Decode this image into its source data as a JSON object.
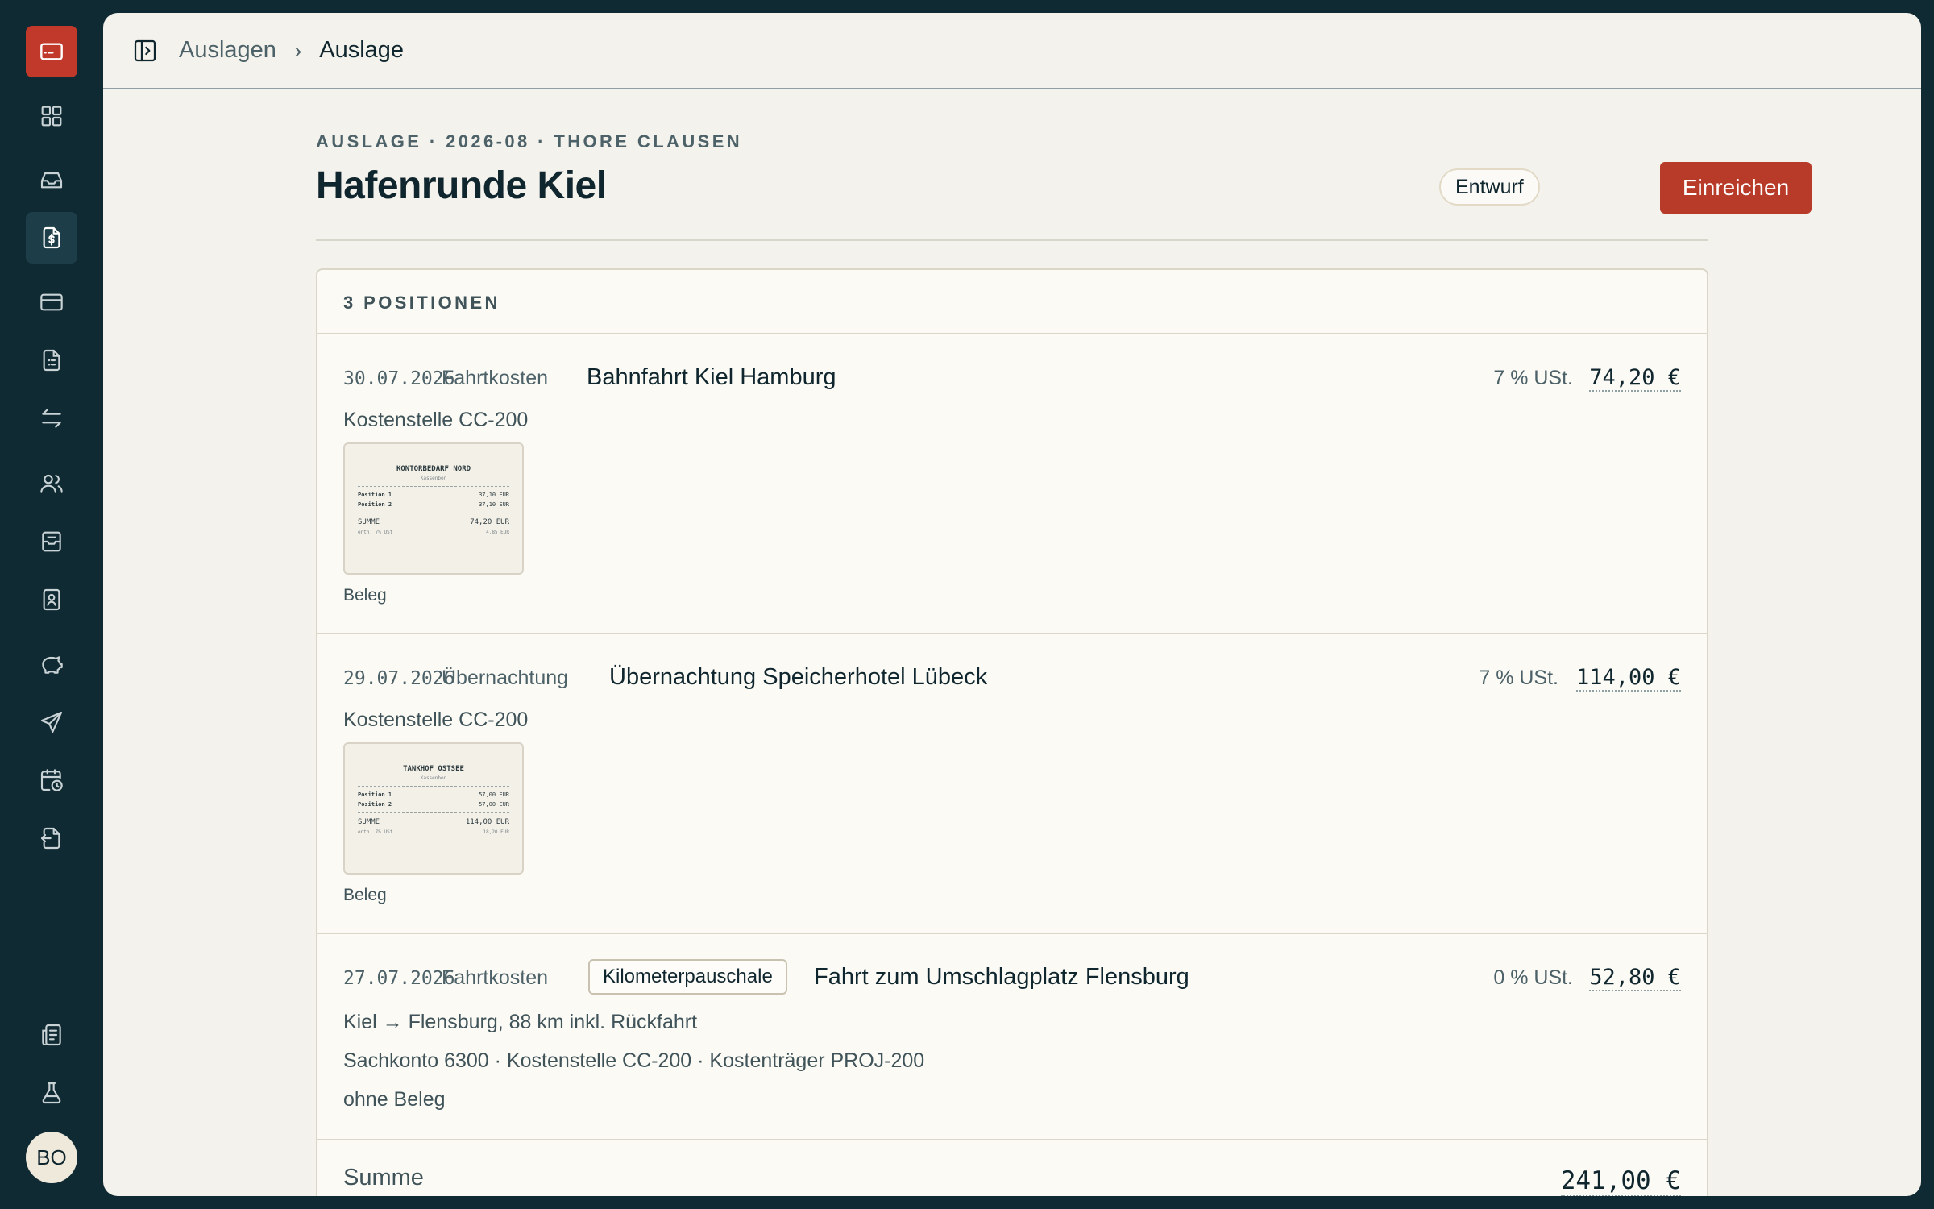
{
  "sidebar": {
    "logo_icon": "card-icon",
    "items": [
      {
        "icon": "dashboard-icon",
        "active": false
      },
      {
        "icon": "inbox-icon",
        "active": false
      },
      {
        "icon": "expense-dollar-icon",
        "active": true
      },
      {
        "icon": "credit-card-icon",
        "active": false
      },
      {
        "icon": "document-icon",
        "active": false
      },
      {
        "icon": "transfer-icon",
        "active": false
      },
      {
        "icon": "users-icon",
        "active": false
      },
      {
        "icon": "archive-icon",
        "active": false
      },
      {
        "icon": "contact-book-icon",
        "active": false
      },
      {
        "icon": "piggy-bank-icon",
        "active": false
      },
      {
        "icon": "send-icon",
        "active": false
      },
      {
        "icon": "calendar-clock-icon",
        "active": false
      },
      {
        "icon": "export-icon",
        "active": false
      }
    ],
    "bottom_items": [
      {
        "icon": "reports-icon"
      },
      {
        "icon": "lab-flask-icon"
      }
    ],
    "avatar_initials": "BO"
  },
  "breadcrumb": {
    "parent": "Auslagen",
    "current": "Auslage"
  },
  "header": {
    "eyebrow": "AUSLAGE · 2026-08 · THORE CLAUSEN",
    "title": "Hafenrunde Kiel",
    "status": "Entwurf",
    "submit_label": "Einreichen"
  },
  "positions": {
    "heading": "3 POSITIONEN",
    "items": [
      {
        "date": "30.07.2026",
        "category": "Fahrtkosten",
        "title": "Bahnfahrt Kiel Hamburg",
        "vat": "7 % USt.",
        "amount": "74,20 €",
        "cost_center": "Kostenstelle CC-200",
        "receipt": {
          "vendor": "KONTORBEDARF NORD",
          "subtitle": "Kassenbon",
          "line1_label": "Position 1",
          "line1_value": "37,10 EUR",
          "line2_label": "Position 2",
          "line2_value": "37,10 EUR",
          "sum_label": "SUMME",
          "sum_value": "74,20 EUR",
          "tax_label": "enth. 7% USt",
          "tax_value": "4,85 EUR"
        },
        "receipt_label": "Beleg"
      },
      {
        "date": "29.07.2026",
        "category": "Übernachtung",
        "title": "Übernachtung Speicherhotel Lübeck",
        "vat": "7 % USt.",
        "amount": "114,00 €",
        "cost_center": "Kostenstelle CC-200",
        "receipt": {
          "vendor": "TANKHOF OSTSEE",
          "subtitle": "Kassenbon",
          "line1_label": "Position 1",
          "line1_value": "57,00 EUR",
          "line2_label": "Position 2",
          "line2_value": "57,00 EUR",
          "sum_label": "SUMME",
          "sum_value": "114,00 EUR",
          "tax_label": "enth. 7% USt",
          "tax_value": "18,20 EUR"
        },
        "receipt_label": "Beleg"
      },
      {
        "date": "27.07.2026",
        "category": "Fahrtkosten",
        "tag": "Kilometerpauschale",
        "title": "Fahrt zum Umschlagplatz Flensburg",
        "vat": "0 % USt.",
        "amount": "52,80 €",
        "route": "Kiel → Flensburg, 88 km inkl. Rückfahrt",
        "accounts": "Sachkonto 6300 · Kostenstelle CC-200 · Kostenträger PROJ-200",
        "receipt_note": "ohne Beleg"
      }
    ],
    "total_label": "Summe",
    "total_amount": "241,00 €"
  },
  "colors": {
    "sidebar_bg": "#0f2a33",
    "accent": "#c0392b",
    "page_bg": "#f4f2ec",
    "card_bg": "#fbfaf5"
  }
}
